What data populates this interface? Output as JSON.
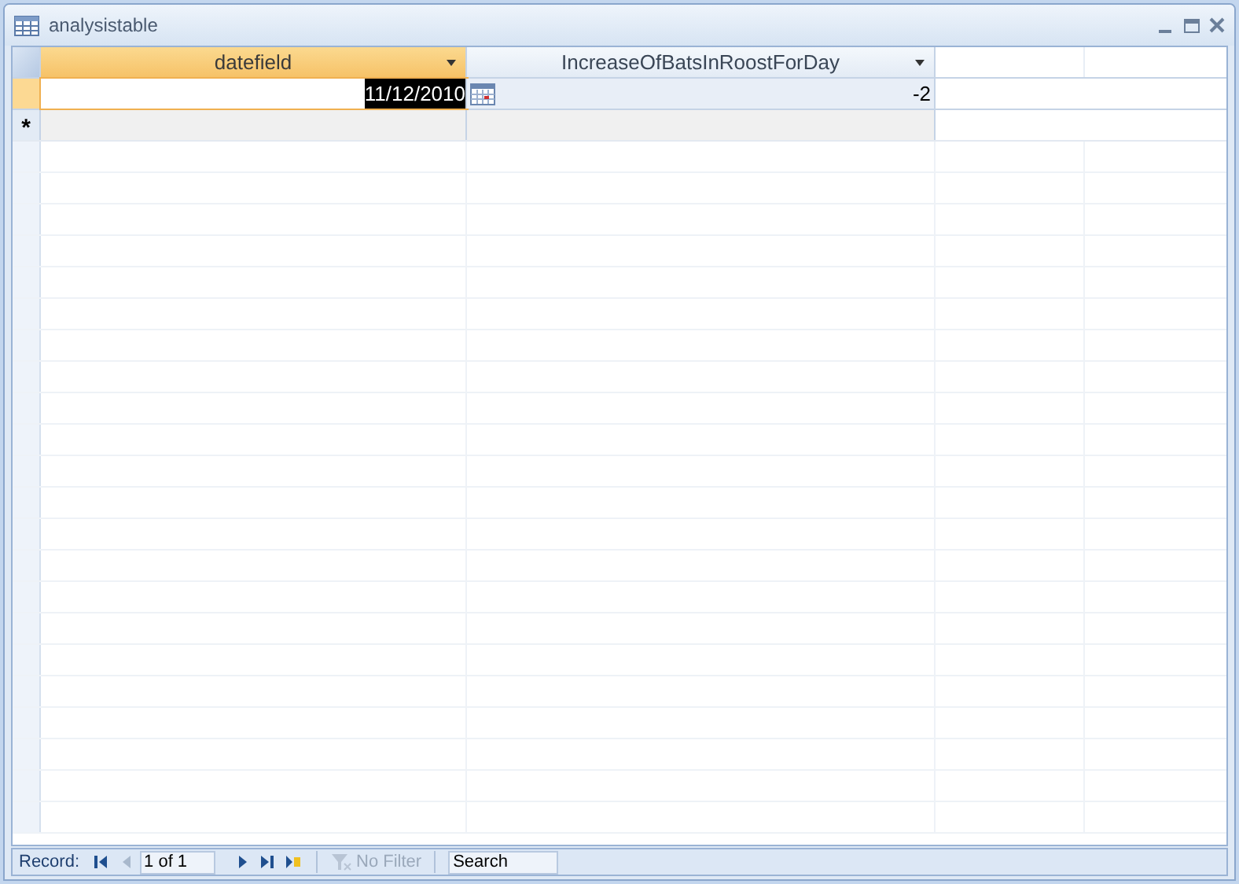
{
  "window": {
    "title": "analysistable"
  },
  "table": {
    "columns": [
      {
        "label": "datefield",
        "selected": true
      },
      {
        "label": "IncreaseOfBatsInRoostForDay",
        "selected": false
      }
    ],
    "rows": [
      {
        "selected": true,
        "cells": [
          "11/12/2010",
          "-2"
        ]
      }
    ],
    "new_row_marker": "*"
  },
  "navigation": {
    "label": "Record:",
    "position": "1 of 1",
    "buttons": [
      {
        "kind": "first",
        "disabled": false
      },
      {
        "kind": "prev",
        "disabled": true
      },
      {
        "kind": "next",
        "disabled": false
      },
      {
        "kind": "last",
        "disabled": false
      },
      {
        "kind": "new",
        "disabled": false
      }
    ],
    "filter": {
      "label": "No Filter",
      "disabled": true
    },
    "search": {
      "placeholder": "Search"
    }
  }
}
